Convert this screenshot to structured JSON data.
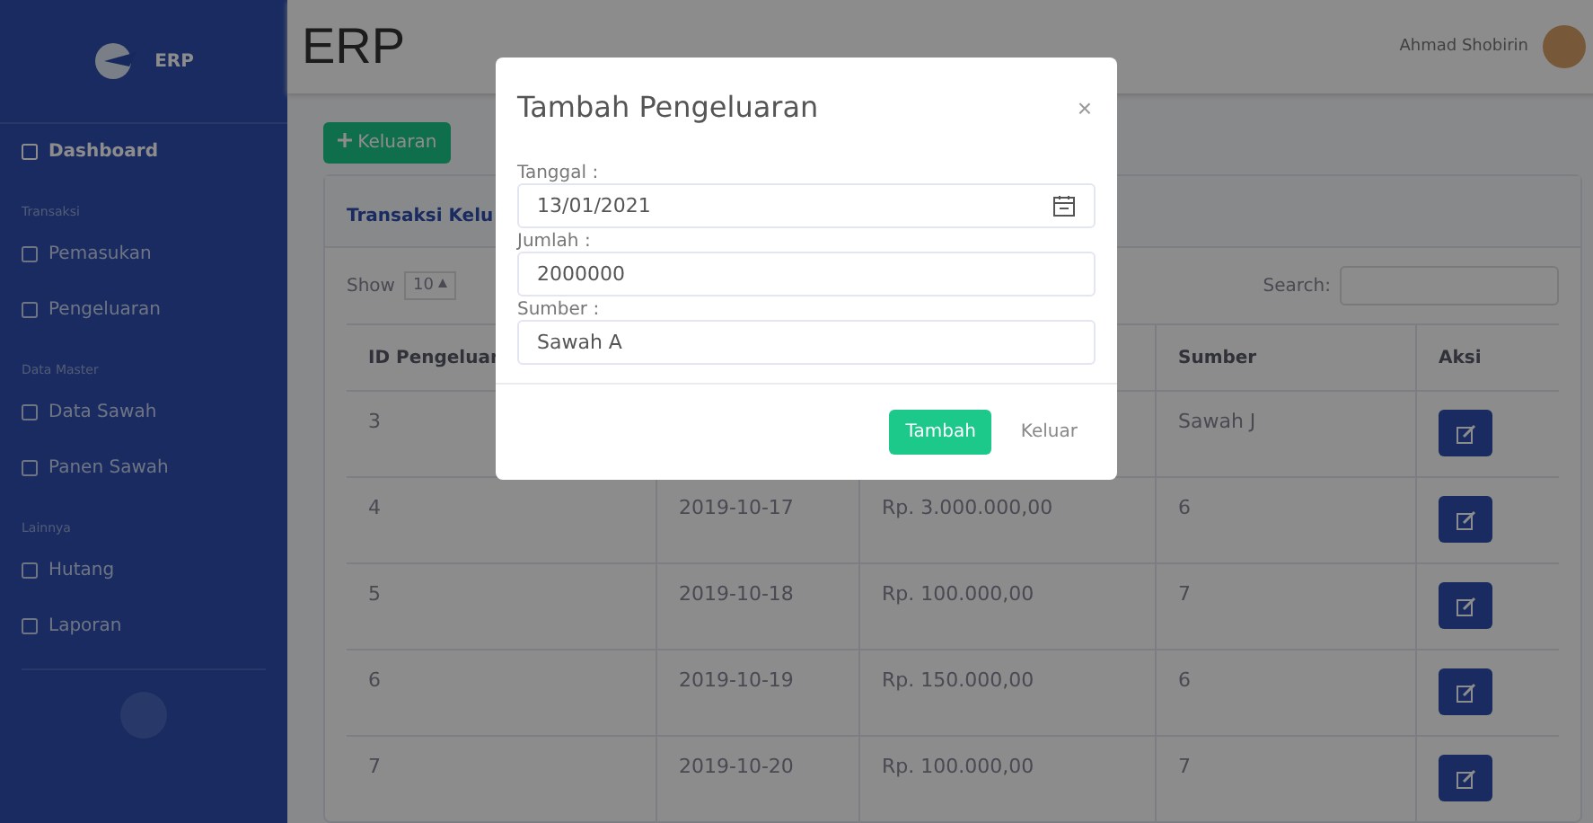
{
  "sidebar": {
    "brand": "ERP",
    "items": [
      {
        "kind": "item",
        "label": "Dashboard",
        "selected": true
      },
      {
        "kind": "heading",
        "label": "Transaksi"
      },
      {
        "kind": "item",
        "label": "Pemasukan",
        "selected": false
      },
      {
        "kind": "item",
        "label": "Pengeluaran",
        "selected": false
      },
      {
        "kind": "heading",
        "label": "Data Master"
      },
      {
        "kind": "item",
        "label": "Data Sawah",
        "selected": false
      },
      {
        "kind": "item",
        "label": "Panen Sawah",
        "selected": false
      },
      {
        "kind": "heading",
        "label": "Lainnya"
      },
      {
        "kind": "item",
        "label": "Hutang",
        "selected": false
      },
      {
        "kind": "item",
        "label": "Laporan",
        "selected": false
      }
    ]
  },
  "topbar": {
    "title": "ERP",
    "user": "Ahmad Shobirin"
  },
  "add_button": "Keluaran",
  "card": {
    "title": "Transaksi Kelu",
    "show_label": "Show",
    "page_size": "10",
    "search_label": "Search:",
    "columns": {
      "id": "ID Pengeluar",
      "sumber": "Sumber",
      "aksi": "Aksi"
    },
    "rows": [
      {
        "id": "3",
        "sumber": "Sawah J"
      },
      {
        "id": "4",
        "tanggal": "2019-10-17",
        "jumlah": "Rp. 3.000.000,00",
        "sumber": "6"
      },
      {
        "id": "5",
        "tanggal": "2019-10-18",
        "jumlah": "Rp. 100.000,00",
        "sumber": "7"
      },
      {
        "id": "6",
        "tanggal": "2019-10-19",
        "jumlah": "Rp. 150.000,00",
        "sumber": "6"
      },
      {
        "id": "7",
        "tanggal": "2019-10-20",
        "jumlah": "Rp. 100.000,00",
        "sumber": "7"
      }
    ]
  },
  "modal": {
    "title": "Tambah Pengeluaran",
    "close": "×",
    "fields": [
      {
        "kind": "date",
        "label": "Tanggal :",
        "value": "13/01/2021"
      },
      {
        "kind": "text",
        "label": "Jumlah :",
        "value": "2000000"
      },
      {
        "kind": "text",
        "label": "Sumber :",
        "value": "Sawah A"
      }
    ],
    "submit": "Tambah",
    "cancel": "Keluar"
  }
}
